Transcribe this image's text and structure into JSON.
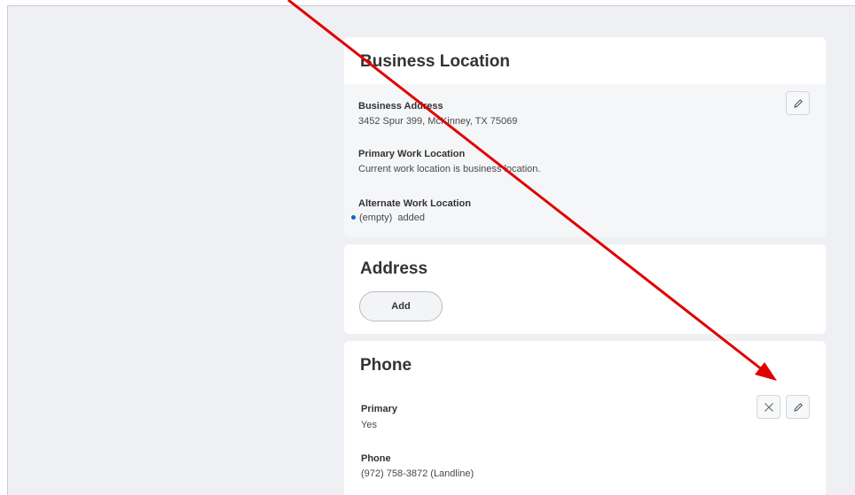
{
  "business_location": {
    "title": "Business Location",
    "business_address": {
      "label": "Business Address",
      "value": "3452 Spur 399, McKinney, TX 75069"
    },
    "primary_work_location": {
      "label": "Primary Work Location",
      "value": "Current work location is business location."
    },
    "alternate_work_location": {
      "label": "Alternate Work Location",
      "value": "(empty)  added"
    },
    "edit_icon": "pencil-icon"
  },
  "address": {
    "title": "Address",
    "add_label": "Add"
  },
  "phone": {
    "title": "Phone",
    "primary": {
      "label": "Primary",
      "value": "Yes"
    },
    "phone": {
      "label": "Phone",
      "value": "(972) 758-3872 (Landline)"
    },
    "delete_icon": "close-icon",
    "edit_icon": "pencil-icon"
  },
  "colors": {
    "annotation_arrow": "#e00000",
    "change_indicator": "#0b63c5",
    "background": "#eef0f3"
  }
}
